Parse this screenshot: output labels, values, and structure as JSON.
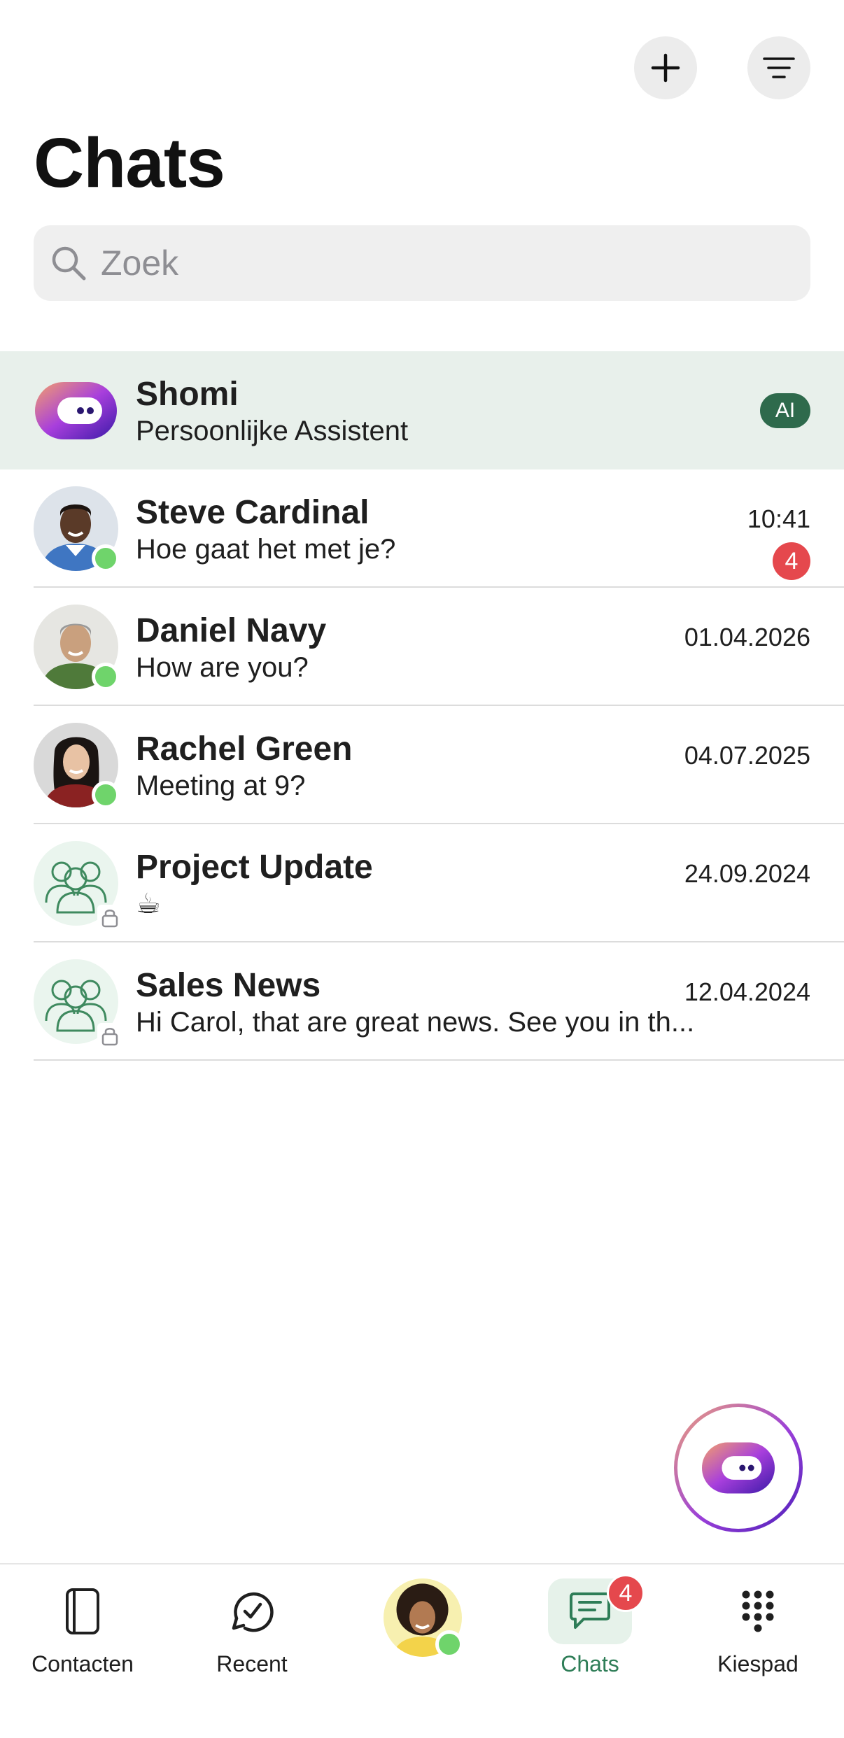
{
  "header": {
    "title": "Chats",
    "add_icon": "plus-icon",
    "filter_icon": "filter-lines-icon"
  },
  "search": {
    "placeholder": "Zoek",
    "icon": "search-icon"
  },
  "chats": [
    {
      "name": "Shomi",
      "message": "Persoonlijke Assistent",
      "badge": "AI",
      "type": "assistant"
    },
    {
      "name": "Steve Cardinal",
      "message": "Hoe gaat het met je?",
      "time": "10:41",
      "unread": "4",
      "online": true
    },
    {
      "name": "Daniel Navy",
      "message": "How are you?",
      "time": "01.04.2026",
      "online": true
    },
    {
      "name": "Rachel Green",
      "message": "Meeting at 9?",
      "time": "04.07.2025",
      "online": true
    },
    {
      "name": "Project Update",
      "message": "☕",
      "time": "24.09.2024",
      "type": "group"
    },
    {
      "name": "Sales News",
      "message": "Hi Carol, that are great news. See you in th...",
      "time": "12.04.2024",
      "type": "group"
    }
  ],
  "tabbar": {
    "contacts": "Contacten",
    "recent": "Recent",
    "chats": "Chats",
    "chats_badge": "4",
    "keypad": "Kiespad"
  },
  "colors": {
    "accent_green": "#2e7d57",
    "ai_row_bg": "#e8f0eb",
    "unread_red": "#e5484d",
    "online_green": "#6fd46b"
  }
}
